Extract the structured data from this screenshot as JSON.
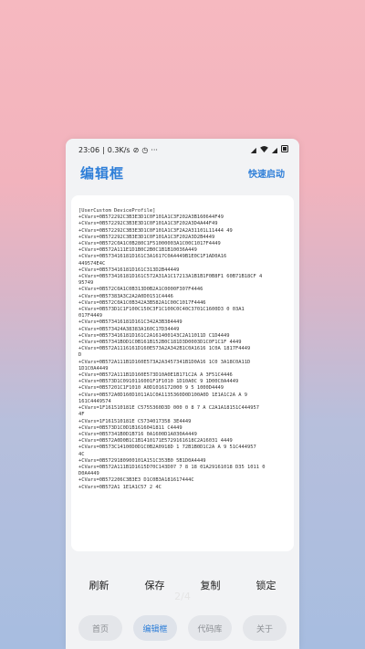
{
  "status_bar": {
    "time": "23:06",
    "network_speed": "0.3K/s",
    "dots": "···"
  },
  "header": {
    "title": "编辑框",
    "quick_start": "快速启动"
  },
  "editor": {
    "content": "[UserCustom DeviceProfile]\n+CVars=0B572292C3B3E3D1C0F101A1C3F202A3B160644F49\n+CVars=0B572292C3B3E3D1C0F101A1C3F202A3D4A44F49\n+CVars=0B572292C3B3E3D1C0F101A1C3F2A2A31101L11444 49\n+CVars=0B572292C3B3E3D1C0F101A1C3F202A3D2B4449\n+CVars=0B572C0A1C0B280C1F51000003A1C00C1017F4449\n+CVars=0B572A111E1D1B0C2B0C1B1B10036A449\n+CVars=0B573416181D161C3A1617C0A4449B1E0C1F1AD0A16\n449574E4C\n+CVars=0B573416181D161C313D2B44449\n+CVars=0B573416181D161C572A31A1C17213A1B1B1F0B8F1 60B71B18CF 4\n95749\n+CVars=0B572C0A1C0B313D0B2A1C0000F307F4446\n+CVars=0B57383A3C2A2A0D0151C4446\n+CVars=0B572C0A1C0B342A3B582A1C00C1017F4446\n+CVars=0B573D1C1F100C150C3F1C100C0C40C3701C1600D3 0 03A1\n017F4449\n+CVars=0B573416181D161C342A3B384449\n+CVars=0B573424A38383A160C17D34449\n+CVars=0B573416181D161C2A161400143C2A11011D C1D4449\n+CVars=0B57341BOD1C0B161B152B0C181D3D0003D1C0F1C1F 4449\n+CVars=0B572A1116161D160E573A2A342B1C0A1616 1C0A 1817F4449\nD\n+CVars=0B572A111B1D160E573A2A3457341B1D0A16 1C0 3A18C0A11D\n1D1C0A4449\n+CVars=0B572A111B1D160E573D10A0E1B171C2A A 3F51C4446\n+CVars=0B573D1C0910116001F1F1010 1D10A0C 9 1D00C0A4449\n+CVars=0B57201C1F1010 A0D1016172000 9 5 1000D4449\n+CVars=0B572A0D160D1011A1C0A1135360D0D100A0D 1E1A1C2A A 9\n161C4449574\n+CVars=1F161510181E C5755360D3D 000 0 8 7 A C2A1A18151C444957\n4F\n+CVars=1F161510181E C5734017358 3E4449\n+CVars=0B573D1C0D1B1616041811 C4449\n+CVars=0B57341B0D1B716 0A1600D1A030A4449\n+CVars=0B572A0D0B1C1B1410171E5729161618C2A16031 4449\n+CVars=0B573C14100D0D1C0B2A0918D 1 72B1B0D1C2A A 9 51C444957\n4C\n+CVars=0B5729180900101A151C353B0 5B1D0A4449\n+CVars=0B572A111B1D1615D70C143D07 7 8 18 01A29161018 D35 1011 0\nD0A4449\n+CVars=0B572206C3B3E3 D1C0B3A181617444C\n+CVars=0B572A1 1E1A1C57 2 4C"
  },
  "actions": {
    "refresh": "刷新",
    "save": "保存",
    "copy": "复制",
    "lock": "锁定"
  },
  "page_indicator": "2/4",
  "nav": {
    "home": "首页",
    "editor": "编辑框",
    "code_library": "代码库",
    "about": "关于"
  },
  "colors": {
    "accent": "#2f7fd8",
    "background_top": "#f6b9c0",
    "background_bottom": "#a7bde0"
  }
}
